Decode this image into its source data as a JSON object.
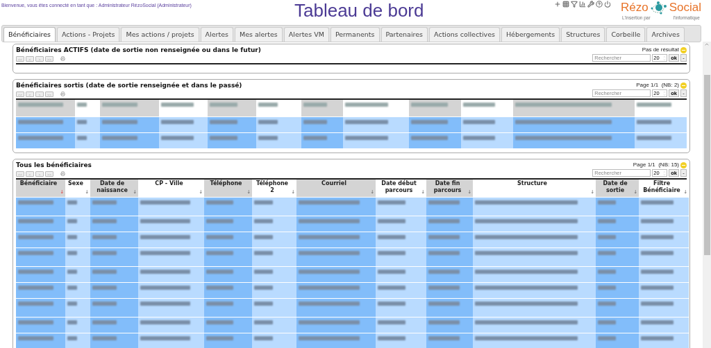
{
  "welcome": "Bienvenue, vous êtes connecté en tant que : Administrateur RézoSocial (Administrateur)",
  "title": "Tableau de bord",
  "logo": {
    "left": "Rézo",
    "right": "Social",
    "tag_left": "L'insertion par",
    "tag_right": "l'informatique"
  },
  "tabs": [
    {
      "label": "Bénéficiaires",
      "selected": true
    },
    {
      "label": "Actions - Projets",
      "selected": false
    },
    {
      "label": "Mes actions / projets",
      "selected": false
    },
    {
      "label": "Alertes",
      "selected": false
    },
    {
      "label": "Mes alertes",
      "selected": false
    },
    {
      "label": "Alertes VM",
      "selected": false
    },
    {
      "label": "Permanents",
      "selected": false
    },
    {
      "label": "Partenaires",
      "selected": false
    },
    {
      "label": "Actions collectives",
      "selected": false
    },
    {
      "label": "Hébergements",
      "selected": false
    },
    {
      "label": "Structures",
      "selected": false
    },
    {
      "label": "Corbeille",
      "selected": false
    },
    {
      "label": "Archives",
      "selected": false
    }
  ],
  "pager_buttons": [
    "<<",
    "<",
    ">",
    ">>"
  ],
  "panels": [
    {
      "title": "Bénéficiaires ACTIFS (date de sortie non renseignée ou dans le futur)",
      "status": "Pas de résultat",
      "kind": "empty",
      "search": {
        "placeholder": "Rechercher",
        "page_size": "20",
        "ok": "ok",
        "collapse": "-"
      }
    },
    {
      "title": "Bénéficiaires sortis (date de sortie renseignée et dans le passé)",
      "status": "Page 1/1  (NB: 2)",
      "kind": "blurred",
      "search": {
        "placeholder": "Rechercher",
        "page_size": "20",
        "ok": "ok",
        "collapse": "-"
      }
    },
    {
      "title": "Tous les bénéficiaires",
      "status": "Page 1/1  (NB: 15)",
      "kind": "table",
      "search": {
        "placeholder": "Rechercher",
        "page_size": "20",
        "ok": "ok",
        "collapse": "-"
      },
      "columns": [
        {
          "label": "Bénéficiaire",
          "sort": "↓",
          "sorted": true
        },
        {
          "label": "Sexe",
          "sort": "↓",
          "sorted": false
        },
        {
          "label": "Date de naissance",
          "sort": "↓",
          "sorted": true
        },
        {
          "label": "CP - Ville",
          "sort": "↓",
          "sorted": false
        },
        {
          "label": "Téléphone",
          "sort": "↓",
          "sorted": true
        },
        {
          "label": "Téléphone 2",
          "sort": "↓",
          "sorted": false
        },
        {
          "label": "Courriel",
          "sort": "↓",
          "sorted": true
        },
        {
          "label": "Date début parcours",
          "sort": "↓",
          "sorted": false
        },
        {
          "label": "Date fin parcours",
          "sort": "↓",
          "sorted": true
        },
        {
          "label": "Structure",
          "sort": "↓",
          "sorted": false
        },
        {
          "label": "Date de sortie",
          "sort": "↓",
          "sorted": true
        },
        {
          "label": "Filtre Bénéficiaire",
          "sort": "↓",
          "sorted": false
        }
      ]
    }
  ]
}
